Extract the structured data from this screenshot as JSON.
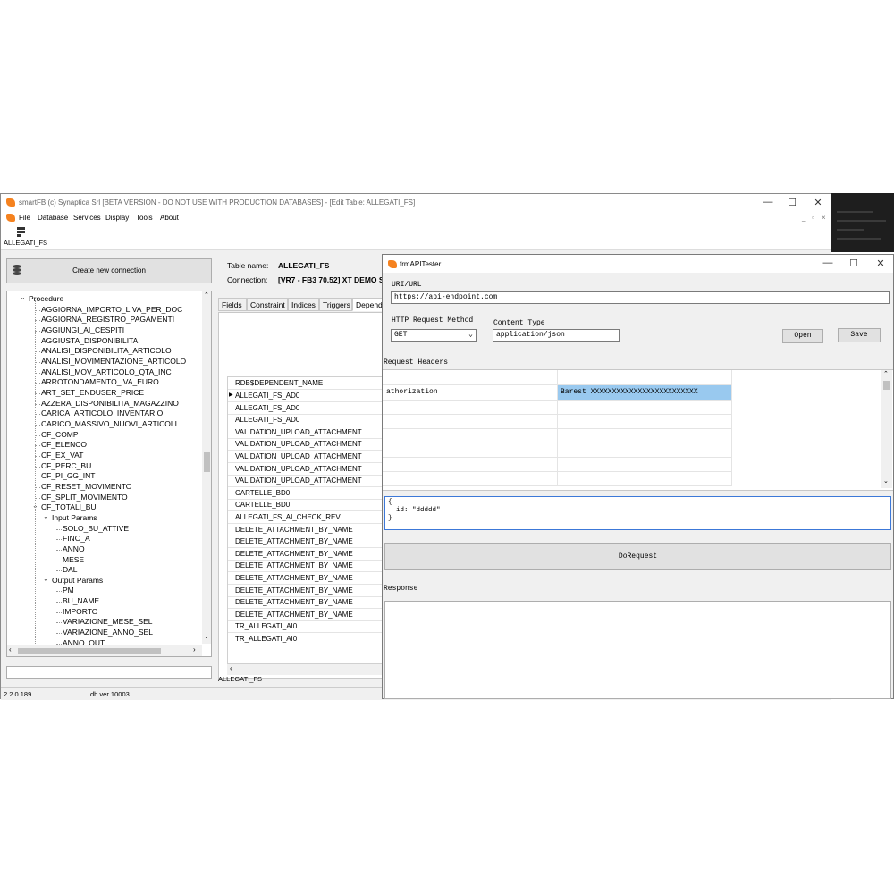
{
  "main_window": {
    "title": "smartFB (c) Synaptica Srl [BETA VERSION - DO NOT USE WITH PRODUCTION DATABASES] - [Edit Table: ALLEGATI_FS]",
    "menu": [
      "File",
      "Database",
      "Services",
      "Display",
      "Tools",
      "About"
    ],
    "toolbar_label": "ALLEGATI_FS",
    "create_connection_label": "Create new connection",
    "tree": [
      {
        "label": "Procedure",
        "level": 0,
        "expanded": true
      },
      {
        "label": "AGGIORNA_IMPORTO_LIVA_PER_DOC",
        "level": 1
      },
      {
        "label": "AGGIORNA_REGISTRO_PAGAMENTI",
        "level": 1
      },
      {
        "label": "AGGIUNGI_AI_CESPITI",
        "level": 1
      },
      {
        "label": "AGGIUSTA_DISPONIBILITA",
        "level": 1
      },
      {
        "label": "ANALISI_DISPONIBILITA_ARTICOLO",
        "level": 1
      },
      {
        "label": "ANALISI_MOVIMENTAZIONE_ARTICOLO",
        "level": 1
      },
      {
        "label": "ANALISI_MOV_ARTICOLO_QTA_INC",
        "level": 1
      },
      {
        "label": "ARROTONDAMENTO_IVA_EURO",
        "level": 1
      },
      {
        "label": "ART_SET_ENDUSER_PRICE",
        "level": 1
      },
      {
        "label": "AZZERA_DISPONIBILITA_MAGAZZINO",
        "level": 1
      },
      {
        "label": "CARICA_ARTICOLO_INVENTARIO",
        "level": 1
      },
      {
        "label": "CARICO_MASSIVO_NUOVI_ARTICOLI",
        "level": 1
      },
      {
        "label": "CF_COMP",
        "level": 1
      },
      {
        "label": "CF_ELENCO",
        "level": 1
      },
      {
        "label": "CF_EX_VAT",
        "level": 1
      },
      {
        "label": "CF_PERC_BU",
        "level": 1
      },
      {
        "label": "CF_PI_GG_INT",
        "level": 1
      },
      {
        "label": "CF_RESET_MOVIMENTO",
        "level": 1
      },
      {
        "label": "CF_SPLIT_MOVIMENTO",
        "level": 1
      },
      {
        "label": "CF_TOTALI_BU",
        "level": 1,
        "expanded": true
      },
      {
        "label": "Input Params",
        "level": 2,
        "expanded": true
      },
      {
        "label": "SOLO_BU_ATTIVE",
        "level": 3
      },
      {
        "label": "FINO_A",
        "level": 3
      },
      {
        "label": "ANNO",
        "level": 3
      },
      {
        "label": "MESE",
        "level": 3
      },
      {
        "label": "DAL",
        "level": 3
      },
      {
        "label": "Output Params",
        "level": 2,
        "expanded": true
      },
      {
        "label": "PM",
        "level": 3
      },
      {
        "label": "BU_NAME",
        "level": 3
      },
      {
        "label": "IMPORTO",
        "level": 3
      },
      {
        "label": "VARIAZIONE_MESE_SEL",
        "level": 3
      },
      {
        "label": "VARIAZIONE_ANNO_SEL",
        "level": 3
      },
      {
        "label": "ANNO_OUT",
        "level": 3
      }
    ],
    "status_version": "2.2.0.189",
    "status_db": "db ver 10003"
  },
  "table_panel": {
    "table_name_label": "Table name:",
    "table_name": "ALLEGATI_FS",
    "connection_label": "Connection:",
    "connection": "[VR7 - FB3 70.52] XT DEMO S",
    "tabs": [
      "Fields",
      "Constraint",
      "Indices",
      "Triggers",
      "Depend"
    ],
    "grid_header": "RDB$DEPENDENT_NAME",
    "grid_rows": [
      "ALLEGATI_FS_AD0",
      "ALLEGATI_FS_AD0",
      "ALLEGATI_FS_AD0",
      "VALIDATION_UPLOAD_ATTACHMENT",
      "VALIDATION_UPLOAD_ATTACHMENT",
      "VALIDATION_UPLOAD_ATTACHMENT",
      "VALIDATION_UPLOAD_ATTACHMENT",
      "VALIDATION_UPLOAD_ATTACHMENT",
      "CARTELLE_BD0",
      "CARTELLE_BD0",
      "ALLEGATI_FS_AI_CHECK_REV",
      "DELETE_ATTACHMENT_BY_NAME",
      "DELETE_ATTACHMENT_BY_NAME",
      "DELETE_ATTACHMENT_BY_NAME",
      "DELETE_ATTACHMENT_BY_NAME",
      "DELETE_ATTACHMENT_BY_NAME",
      "DELETE_ATTACHMENT_BY_NAME",
      "DELETE_ATTACHMENT_BY_NAME",
      "DELETE_ATTACHMENT_BY_NAME",
      "TR_ALLEGATI_AI0",
      "TR_ALLEGATI_AI0"
    ],
    "footer": "ALLEGATI_FS"
  },
  "api_tester": {
    "title": "frmAPITester",
    "url_label": "URI/URL",
    "url_value": "https://api-endpoint.com",
    "method_label": "HTTP Request Method",
    "method_value": "GET",
    "content_type_label": "Content Type",
    "content_type_value": "application/json",
    "open_label": "Open",
    "save_label": "Save",
    "request_headers_label": "Request Headers",
    "header_key": "athorization",
    "header_value": "Barest XXXXXXXXXXXXXXXXXXXXXXXXX",
    "body_lines": [
      "{",
      "  id: \"ddddd\"",
      "}"
    ],
    "do_request_label": "DoRequest",
    "response_label": "Response",
    "accent_color": "#99c9ef"
  }
}
